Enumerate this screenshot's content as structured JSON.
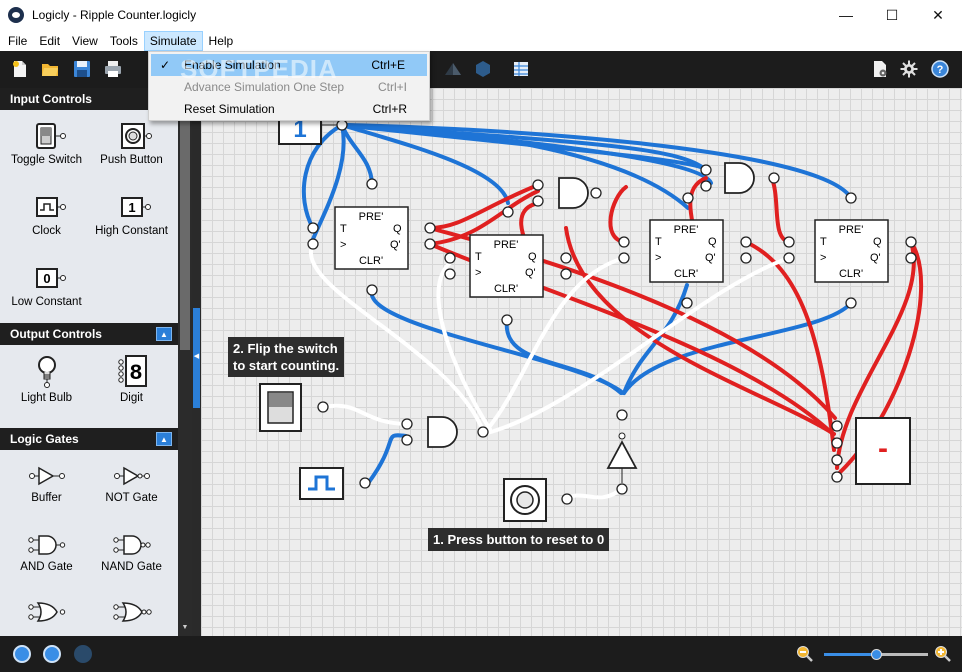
{
  "window": {
    "title": "Logicly - Ripple Counter.logicly",
    "controls": {
      "minimize": "—",
      "maximize": "☐",
      "close": "✕"
    }
  },
  "menubar": {
    "items": [
      "File",
      "Edit",
      "View",
      "Tools",
      "Simulate",
      "Help"
    ],
    "active": "Simulate"
  },
  "simulate_menu": {
    "items": [
      {
        "label": "Enable Simulation",
        "shortcut": "Ctrl+E",
        "checked": true,
        "enabled": true,
        "highlighted": true
      },
      {
        "label": "Advance Simulation One Step",
        "shortcut": "Ctrl+I",
        "checked": false,
        "enabled": false,
        "highlighted": false
      },
      {
        "label": "Reset Simulation",
        "shortcut": "Ctrl+R",
        "checked": false,
        "enabled": true,
        "highlighted": false
      }
    ],
    "check_glyph": "✓"
  },
  "watermark": "SOFTPEDIA",
  "palette": {
    "sections": [
      {
        "title": "Input Controls",
        "collapsible": false,
        "items": [
          "Toggle Switch",
          "Push Button",
          "Clock",
          "High Constant",
          "Low Constant"
        ]
      },
      {
        "title": "Output Controls",
        "collapsible": true,
        "collapse_glyph": "▲",
        "items": [
          "Light Bulb",
          "Digit"
        ]
      },
      {
        "title": "Logic Gates",
        "collapsible": true,
        "collapse_glyph": "▲",
        "items": [
          "Buffer",
          "NOT Gate",
          "AND Gate",
          "NAND Gate"
        ]
      }
    ],
    "icon_text": {
      "high_constant": "1",
      "low_constant": "0",
      "digit": "8"
    },
    "scroll_up": "▲",
    "scroll_down": "▼",
    "splitter_glyph": "◀"
  },
  "circuit": {
    "notes": {
      "flip": "2. Flip the switch\nto start counting.",
      "reset": "1. Press button to reset to 0"
    },
    "flipflop_labels": {
      "pre": "PRE'",
      "clr": "CLR'",
      "t": "T",
      "clk": ">",
      "q": "Q",
      "qn": "Q'"
    },
    "high_constant_value": "1",
    "digit_display": "-",
    "colors": {
      "high_wire": "#e02020",
      "low_wire": "#1e74d6",
      "floating_wire": "#ffffff"
    }
  },
  "zoom": {
    "level": 0.5
  },
  "colors": {
    "toolbar_bg": "#1c1c1c",
    "accent": "#2b7fd8",
    "menu_highlight": "#91c9f7"
  }
}
